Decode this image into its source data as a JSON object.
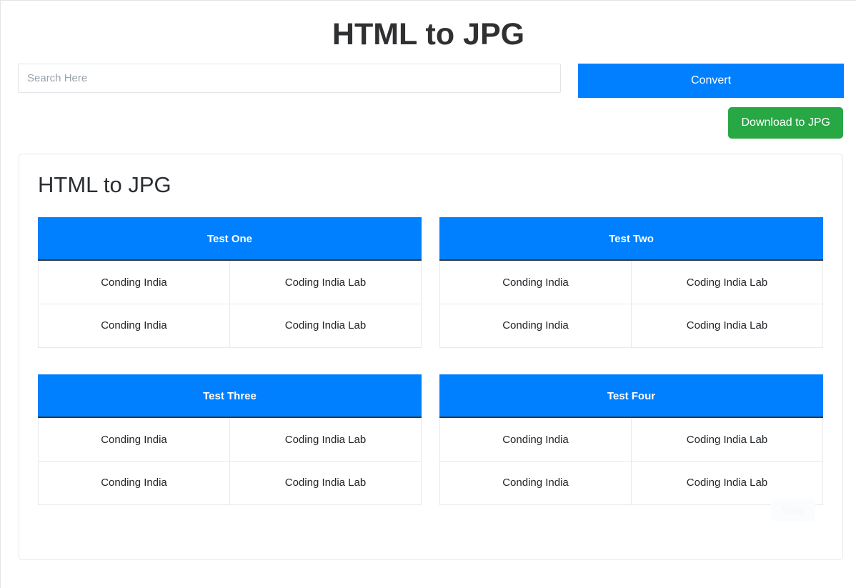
{
  "header": {
    "title": "HTML to JPG"
  },
  "controls": {
    "search_placeholder": "Search Here",
    "search_value": "",
    "convert_label": "Convert",
    "download_label": "Download to JPG"
  },
  "card": {
    "title": "HTML to JPG",
    "ghost_label": "Save",
    "columns": [
      "",
      ""
    ],
    "tables": [
      {
        "header": "Test One",
        "rows": [
          [
            "Conding India",
            "Coding India Lab"
          ],
          [
            "Conding India",
            "Coding India Lab"
          ]
        ]
      },
      {
        "header": "Test Two",
        "rows": [
          [
            "Conding India",
            "Coding India Lab"
          ],
          [
            "Conding India",
            "Coding India Lab"
          ]
        ]
      },
      {
        "header": "Test Three",
        "rows": [
          [
            "Conding India",
            "Coding India Lab"
          ],
          [
            "Conding India",
            "Coding India Lab"
          ]
        ]
      },
      {
        "header": "Test Four",
        "rows": [
          [
            "Conding India",
            "Coding India Lab"
          ],
          [
            "Conding India",
            "Coding India Lab"
          ]
        ]
      }
    ]
  },
  "colors": {
    "primary_blue": "#0080ff",
    "success_green": "#28a745",
    "title_dark": "#2f3032",
    "border_gray": "#e7e9eb",
    "header_underline": "#32383e"
  }
}
